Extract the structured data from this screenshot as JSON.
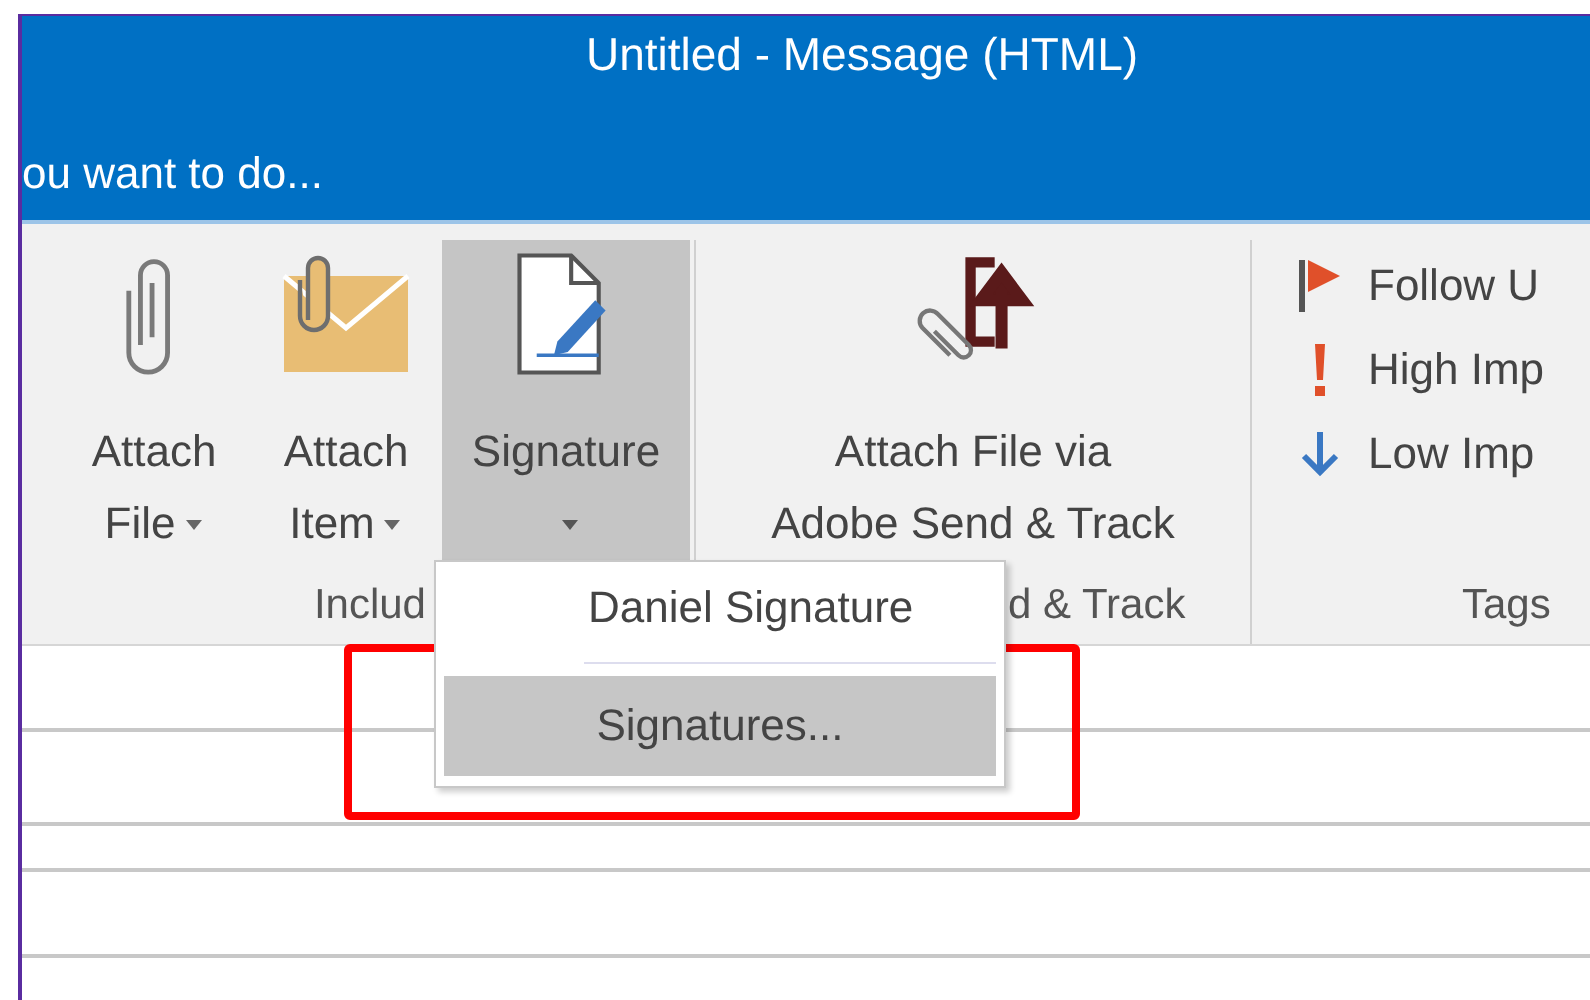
{
  "window": {
    "title": "Untitled - Message (HTML)"
  },
  "tell_me": {
    "text": "ou want to do..."
  },
  "ribbon": {
    "groups": [
      {
        "label": "Includ",
        "buttons": [
          {
            "kind": "attach-file",
            "lines": [
              "Attach",
              "File"
            ],
            "dropdown": true,
            "selected": false
          },
          {
            "kind": "attach-item",
            "lines": [
              "Attach",
              "Item"
            ],
            "dropdown": true,
            "selected": false
          },
          {
            "kind": "signature",
            "lines": [
              "Signature"
            ],
            "dropdown": true,
            "selected": true
          }
        ]
      },
      {
        "label": "d & Track",
        "buttons": [
          {
            "kind": "adobe-send",
            "lines": [
              "Attach File via",
              "Adobe Send & Track"
            ],
            "dropdown": false,
            "selected": false
          }
        ]
      },
      {
        "label": "Tags",
        "items": [
          {
            "kind": "flag",
            "label": "Follow U"
          },
          {
            "kind": "high",
            "label": "High Imp"
          },
          {
            "kind": "low",
            "label": "Low Imp"
          }
        ]
      }
    ]
  },
  "menu": {
    "items": [
      {
        "label": "Daniel Signature",
        "selected": false
      },
      {
        "label": "Signatures...",
        "selected": true
      }
    ]
  }
}
